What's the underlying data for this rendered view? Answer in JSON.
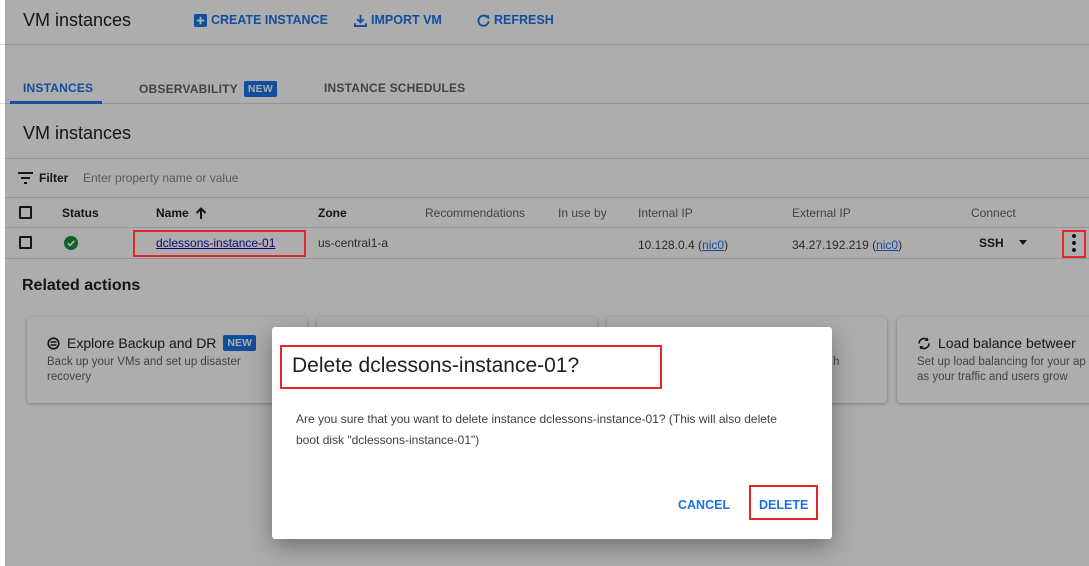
{
  "header": {
    "title": "VM instances",
    "create_label": "CREATE INSTANCE",
    "import_label": "IMPORT VM",
    "refresh_label": "REFRESH",
    "accent_color": "#1a73e8"
  },
  "tabs": [
    {
      "label": "INSTANCES",
      "active": true
    },
    {
      "label": "OBSERVABILITY",
      "badge": "NEW"
    },
    {
      "label": "INSTANCE SCHEDULES"
    }
  ],
  "section_title": "VM instances",
  "filter": {
    "label": "Filter",
    "placeholder": "Enter property name or value",
    "icon": "filter-lines-icon"
  },
  "table": {
    "columns": [
      "Status",
      "Name",
      "Zone",
      "Recommendations",
      "In use by",
      "Internal IP",
      "External IP",
      "Connect"
    ],
    "sort_icon": "arrow-up-icon",
    "rows": [
      {
        "status_icon": "check-circle-icon",
        "status_color": "#1e8e3e",
        "name": "dclessons-instance-01",
        "zone": "us-central1-a",
        "recommendations": "",
        "in_use_by": "",
        "internal_ip": "10.128.0.4",
        "internal_nic": "nic0",
        "external_ip": "34.27.192.219",
        "external_nic": "nic0",
        "connect": "SSH"
      }
    ]
  },
  "related": {
    "title": "Related actions",
    "cards": [
      {
        "title": "Explore Backup and DR",
        "badge": "NEW",
        "desc": "Back up your VMs and set up disaster recovery",
        "icon": "backup-icon"
      },
      {
        "title": "",
        "desc": ""
      },
      {
        "title": "",
        "desc": "h"
      },
      {
        "title": "Load balance betweer",
        "desc": "Set up load balancing for your ap as your traffic and users grow",
        "icon": "load-balance-icon"
      }
    ]
  },
  "dialog": {
    "title": "Delete dclessons-instance-01?",
    "body": "Are you sure that you want to delete instance dclessons-instance-01? (This will also delete boot disk \"dclessons-instance-01\")",
    "cancel_label": "CANCEL",
    "delete_label": "DELETE"
  },
  "highlight_color": "#e3262e"
}
